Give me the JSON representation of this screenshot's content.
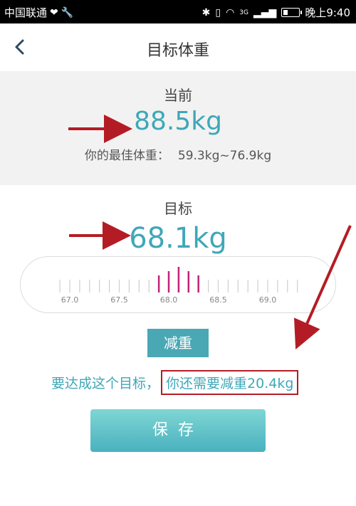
{
  "status": {
    "carrier": "中国联通",
    "network": "3G",
    "time": "晚上9:40"
  },
  "header": {
    "back_icon": "chevron-left-icon",
    "title": "目标体重"
  },
  "current": {
    "label": "当前",
    "value": "88.5kg",
    "best_label": "你的最佳体重：",
    "best_range": "59.3kg~76.9kg"
  },
  "target": {
    "label": "目标",
    "value": "68.1kg"
  },
  "ruler": {
    "tick_labels": [
      "67.0",
      "67.5",
      "68.0",
      "68.5",
      "69.0"
    ],
    "selected_value": 68.1
  },
  "direction_tag": "减重",
  "hint": {
    "prefix": "要达成这个目标，",
    "highlight": "你还需要减重20.4kg"
  },
  "save_label": "保存",
  "colors": {
    "accent": "#3fa7b8",
    "button": "#49b1bf",
    "highlight_tick": "#c2237a",
    "annotation_red": "#b41c25"
  }
}
